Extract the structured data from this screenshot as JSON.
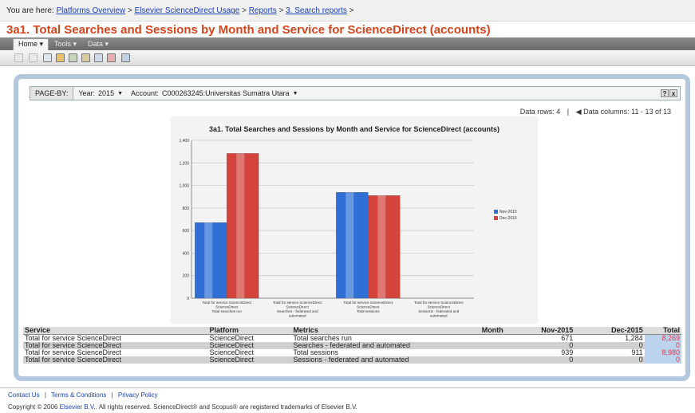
{
  "breadcrumb": {
    "prefix": "You are here:",
    "items": [
      "Platforms Overview",
      "Elsevier ScienceDirect Usage",
      "Reports",
      "3. Search reports"
    ],
    "separator": ">"
  },
  "page_title": "3a1. Total Searches and Sessions by Month and Service for ScienceDirect (accounts)",
  "menu": {
    "home": "Home",
    "tools": "Tools",
    "data": "Data"
  },
  "page_by": {
    "label": "PAGE-BY:",
    "year_label": "Year:",
    "year_value": "2015",
    "account_label": "Account:",
    "account_value": "C000263245:Universitas Sumatra Utara",
    "help": "?",
    "close": "x"
  },
  "data_info": {
    "rows": "Data rows: 4",
    "separator": "|",
    "columns": "Data columns: 11 - 13 of 13"
  },
  "chart_data": {
    "type": "bar",
    "title": "3a1. Total Searches and Sessions by Month and Service for ScienceDirect (accounts)",
    "categories": [
      [
        "Total for service ScienceDirect",
        "ScienceDirect",
        "Total searches run"
      ],
      [
        "Total for service ScienceDirect",
        "ScienceDirect",
        "Searches - federated and",
        "automated"
      ],
      [
        "Total for service ScienceDirect",
        "ScienceDirect",
        "Total sessions"
      ],
      [
        "Total for service ScienceDirect",
        "ScienceDirect",
        "Sessions - federated and",
        "automated"
      ]
    ],
    "series": [
      {
        "name": "Nov-2015",
        "color": "#2f6fd6",
        "values": [
          671,
          0,
          939,
          0
        ]
      },
      {
        "name": "Dec-2015",
        "color": "#d2443c",
        "values": [
          1284,
          0,
          911,
          0
        ]
      }
    ],
    "y_ticks": [
      "0",
      "200",
      "400",
      "600",
      "800",
      "1,000",
      "1,200",
      "1,400"
    ],
    "ylim": [
      0,
      1400
    ],
    "grid": true,
    "legend": "right"
  },
  "table": {
    "headers": [
      "Service",
      "Platform",
      "Metrics",
      "Month",
      "Nov-2015",
      "Dec-2015",
      "Total"
    ],
    "rows": [
      [
        "Total for service ScienceDirect",
        "ScienceDirect",
        "Total searches run",
        "",
        "671",
        "1,284",
        "8,269"
      ],
      [
        "Total for service ScienceDirect",
        "ScienceDirect",
        "Searches - federated and automated",
        "",
        "0",
        "0",
        "0"
      ],
      [
        "Total for service ScienceDirect",
        "ScienceDirect",
        "Total sessions",
        "",
        "939",
        "911",
        "8,980"
      ],
      [
        "Total for service ScienceDirect",
        "ScienceDirect",
        "Sessions - federated and automated",
        "",
        "0",
        "0",
        "0"
      ]
    ]
  },
  "footer": {
    "links": [
      "Contact Us",
      "Terms & Conditions",
      "Privacy Policy"
    ],
    "separator": "|",
    "copyright_prefix": "Copyright © 2006",
    "copyright_link": "Elsevier B.V.",
    "copyright_suffix": "All rights reserved. ScienceDirect® and Scopus® are registered trademarks of Elsevier B.V."
  }
}
